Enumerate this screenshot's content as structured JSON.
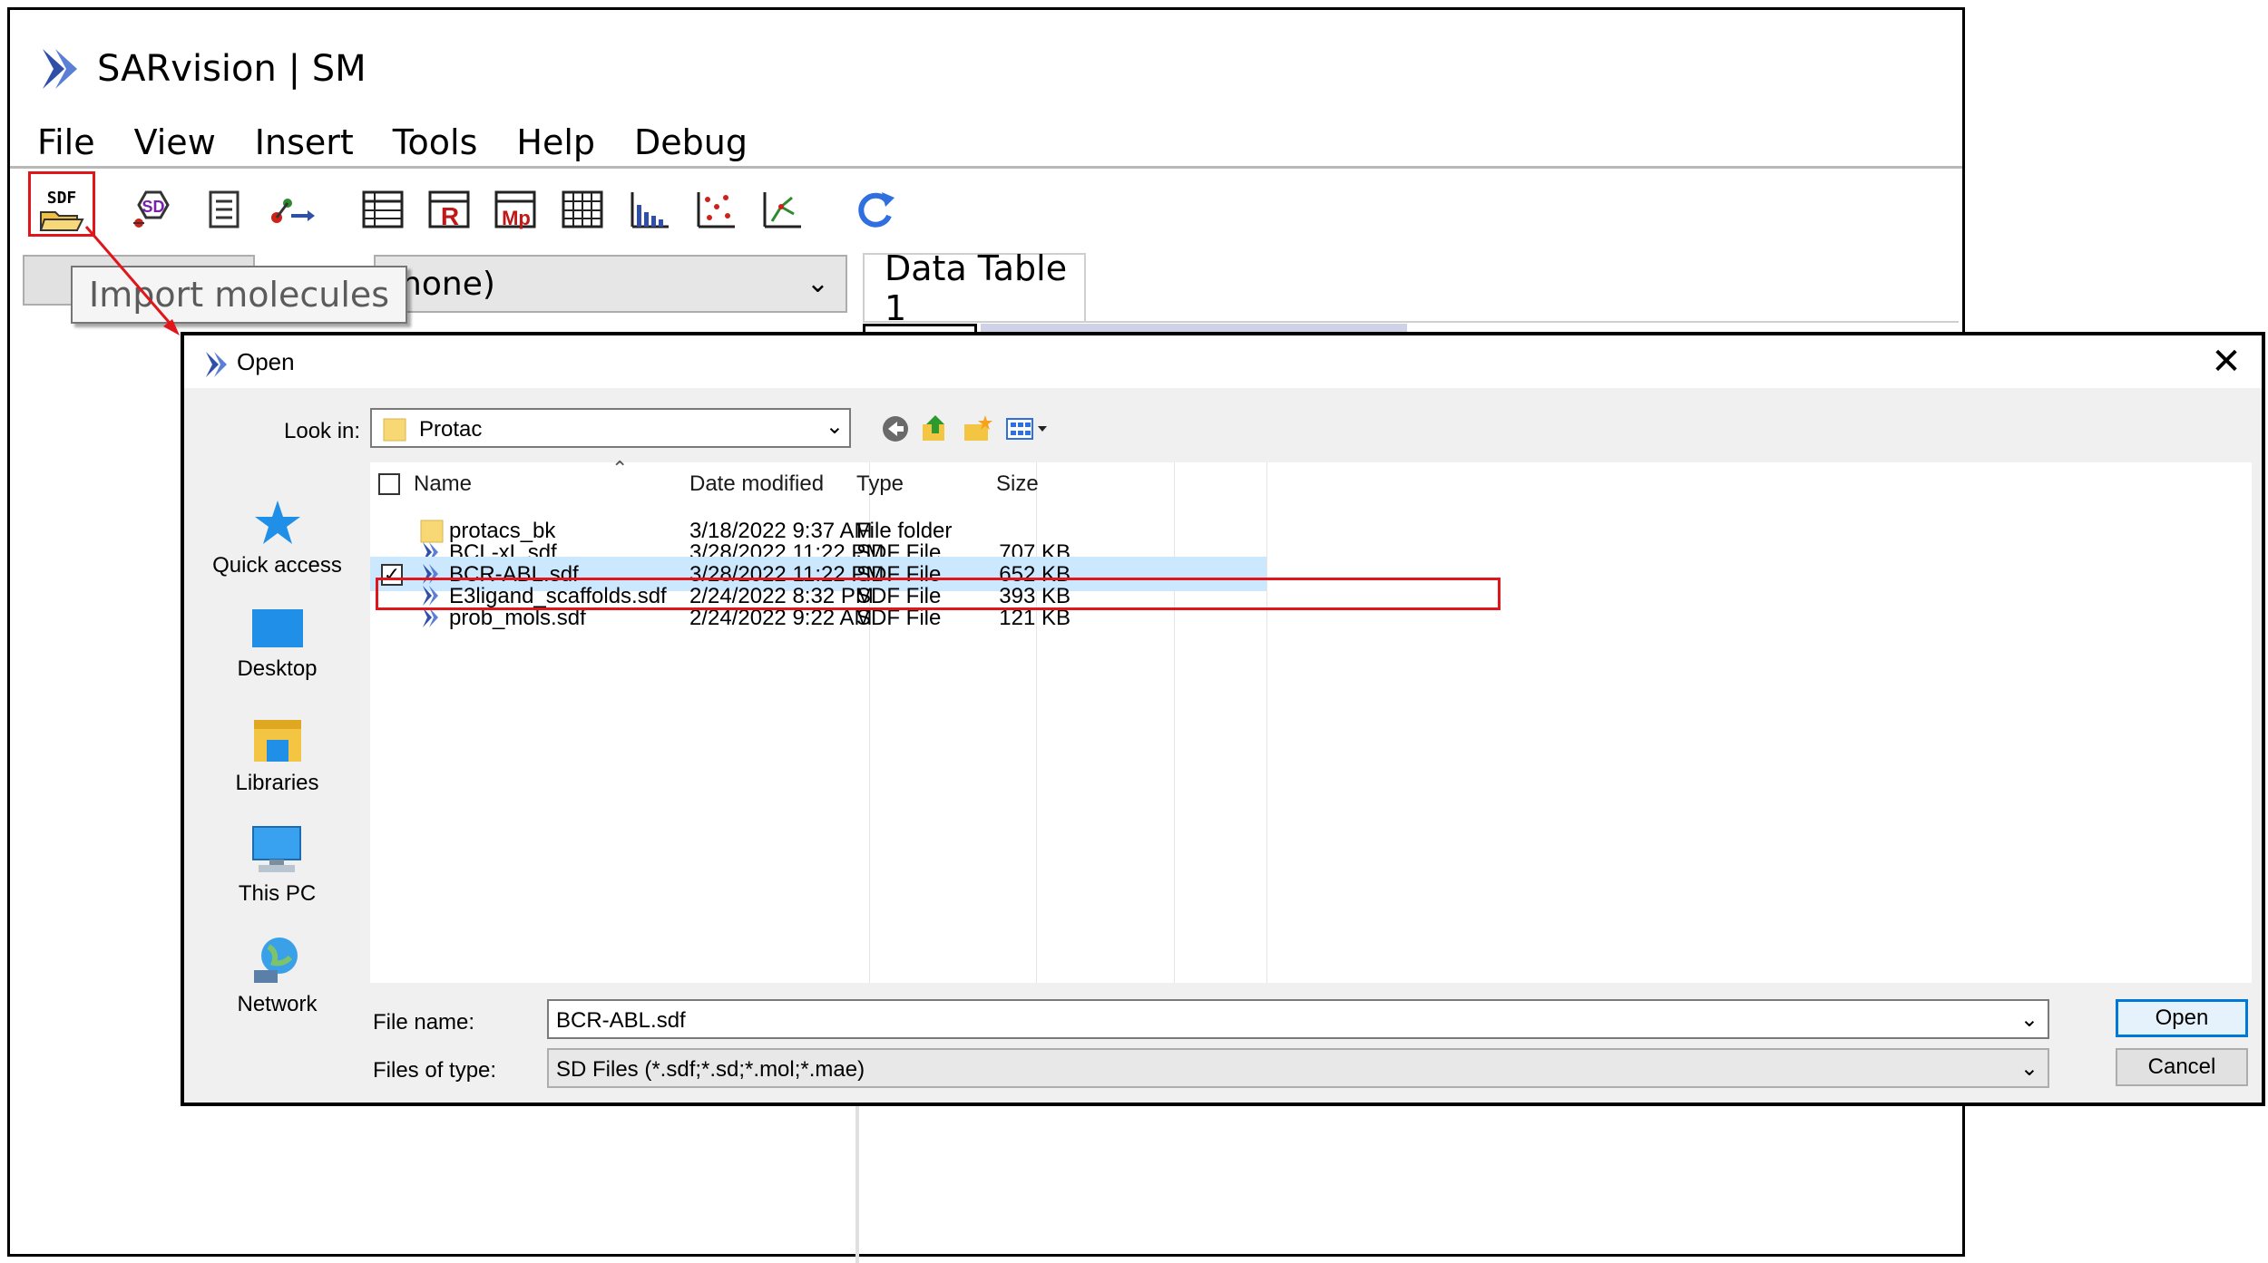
{
  "app": {
    "title": "SARvision | SM"
  },
  "menu": [
    "File",
    "View",
    "Insert",
    "Tools",
    "Help",
    "Debug"
  ],
  "toolbar": {
    "import_icon_text": "SDF",
    "accent_color": "#e0161b",
    "icons": [
      "import-sdf-icon",
      "molecule-search-icon",
      "text-list-icon",
      "reaction-icon",
      "data-table-icon",
      "r-group-table-icon",
      "mp-table-icon",
      "grid-icon",
      "histogram-icon",
      "scatter-plot-icon",
      "tree-plot-icon",
      "refresh-icon"
    ]
  },
  "tooltip": "Import molecules",
  "filter_select": {
    "value": "(none)"
  },
  "tab": {
    "label": "Data Table 1"
  },
  "dialog": {
    "title": "Open",
    "close_label": "✕",
    "look_in_label": "Look in:",
    "look_in_value": "Protac",
    "columns": [
      "Name",
      "Date modified",
      "Type",
      "Size"
    ],
    "places": [
      "Quick access",
      "Desktop",
      "Libraries",
      "This PC",
      "Network"
    ],
    "files": [
      {
        "name": "protacs_bk",
        "date": "3/18/2022 9:37 AM",
        "type": "File folder",
        "size": "",
        "icon": "folder-icon",
        "selected": false
      },
      {
        "name": "BCL-xL.sdf",
        "date": "3/28/2022 11:22 PM",
        "type": "SDF File",
        "size": "707 KB",
        "icon": "sdf-file-icon",
        "selected": false
      },
      {
        "name": "BCR-ABL.sdf",
        "date": "3/28/2022 11:22 PM",
        "type": "SDF File",
        "size": "652 KB",
        "icon": "sdf-file-icon",
        "selected": true
      },
      {
        "name": "E3ligand_scaffolds.sdf",
        "date": "2/24/2022 8:32 PM",
        "type": "SDF File",
        "size": "393 KB",
        "icon": "sdf-file-icon",
        "selected": false
      },
      {
        "name": "prob_mols.sdf",
        "date": "2/24/2022 9:22 AM",
        "type": "SDF File",
        "size": "121 KB",
        "icon": "sdf-file-icon",
        "selected": false
      }
    ],
    "file_name_label": "File name:",
    "file_name_value": "BCR-ABL.sdf",
    "file_type_label": "Files of type:",
    "file_type_value": "SD Files (*.sdf;*.sd;*.mol;*.mae)",
    "open_button": "Open",
    "cancel_button": "Cancel"
  }
}
